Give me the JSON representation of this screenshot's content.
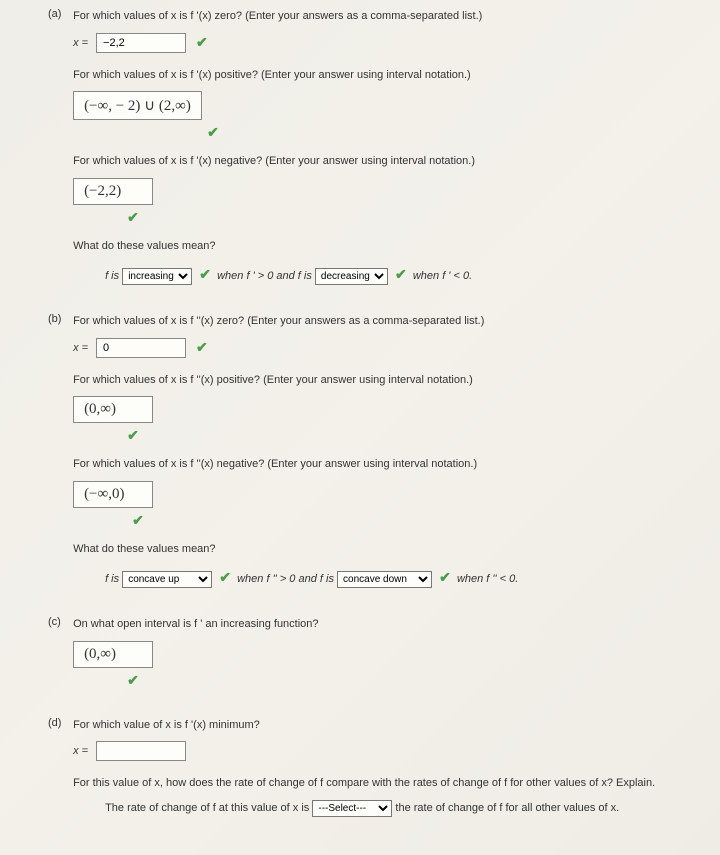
{
  "partA": {
    "label": "(a)",
    "q1": "For which values of x is f '(x) zero? (Enter your answers as a comma-separated list.)",
    "xeq": "x =",
    "a1": "−2,2",
    "q2": "For which values of x is f '(x) positive? (Enter your answer using interval notation.)",
    "a2": "(−∞, − 2) ∪ (2,∞)",
    "q3": "For which values of x is f '(x) negative? (Enter your answer using interval notation.)",
    "a3": "(−2,2)",
    "q4": "What do these values mean?",
    "mean_pre": "f is",
    "sel_inc_options": [
      "increasing",
      "decreasing"
    ],
    "sel_inc_value": "increasing",
    "mean_mid1": "when f ' > 0 and f is",
    "sel_dec_value": "decreasing",
    "mean_end": "when f ' < 0."
  },
  "partB": {
    "label": "(b)",
    "q1": "For which values of x is f ''(x) zero? (Enter your answers as a comma-separated list.)",
    "xeq": "x =",
    "a1": "0",
    "q2": "For which values of x is f ''(x) positive? (Enter your answer using interval notation.)",
    "a2": "(0,∞)",
    "q3": "For which values of x is f ''(x) negative? (Enter your answer using interval notation.)",
    "a3": "(−∞,0)",
    "q4": "What do these values mean?",
    "mean_pre": "f is",
    "sel_cu_options": [
      "concave up",
      "concave down"
    ],
    "sel_cu_value": "concave up",
    "mean_mid1": "when f '' > 0 and f is",
    "sel_cd_value": "concave down",
    "mean_end": "when f '' < 0."
  },
  "partC": {
    "label": "(c)",
    "q1": "On what open interval is f ' an increasing function?",
    "a1": "(0,∞)"
  },
  "partD": {
    "label": "(d)",
    "q1": "For which value of x is f '(x) minimum?",
    "xeq": "x =",
    "a1": "",
    "q2": "For this value of x, how does the rate of change of f compare with the rates of change of f for other values of x? Explain.",
    "line_pre": "The rate of change of f at this value of x is",
    "sel_placeholder": "---Select---",
    "line_post": "the rate of change of f for all other values of x."
  }
}
